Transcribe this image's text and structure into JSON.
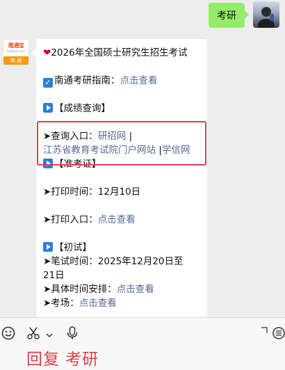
{
  "user_message": {
    "text": "考研"
  },
  "bot_avatar": {
    "logo_text": "南通宝",
    "logo_sub": "baotlian.com",
    "logo_bottom": "南 通"
  },
  "bot_message": {
    "title": "2026年全国硕士研究生招生考试",
    "guide_prefix": "南通考研指南：",
    "guide_link": "点击查看",
    "section_score": "【成绩查询】",
    "query_prefix": "➤查询入口：",
    "query_link1": "研招网",
    "query_sep1": " |",
    "query_link2": "江苏省教育考试院门户网站",
    "query_sep2": " |",
    "query_link3": "学信网",
    "section_admit": "【准考证】",
    "print_time": "➤打印时间：12月10日",
    "print_entry_prefix": "➤打印入口：",
    "print_entry_link": "点击查看",
    "section_exam": "【初试】",
    "written_time_line1": "➤笔试时间：2025年12月20日至",
    "written_time_line2": "21日",
    "schedule_prefix": "➤具体时间安排：",
    "schedule_link": "点击查看",
    "venue_prefix": "➤考场：",
    "venue_link": "点击查看"
  },
  "toolbar": {
    "icons": [
      "emoji-icon",
      "scissors-icon",
      "chevron-down-icon",
      "microphone-icon",
      "expand-icon",
      "menu-icon"
    ]
  },
  "annotation": {
    "text": "回复 考研"
  },
  "colors": {
    "link": "#576b95",
    "user_bubble": "#95ec69",
    "highlight": "#e03e4c"
  }
}
